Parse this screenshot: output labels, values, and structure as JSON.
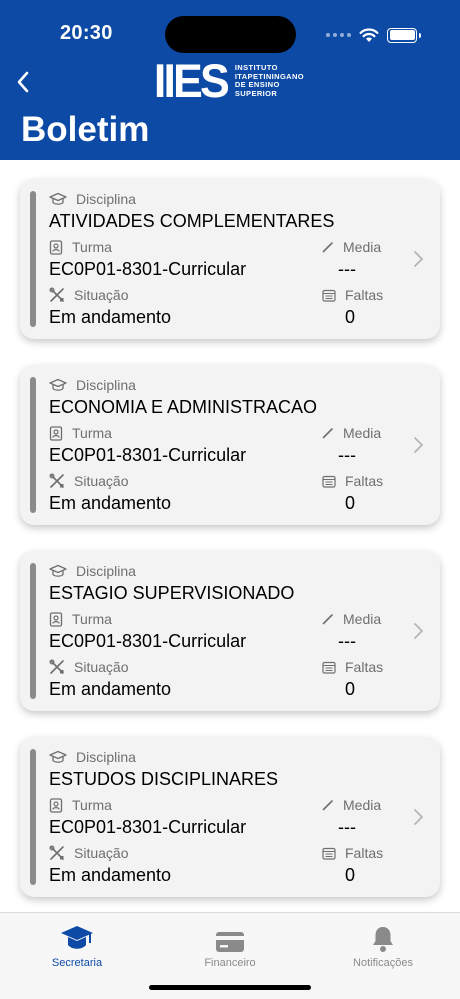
{
  "status_bar": {
    "time": "20:30"
  },
  "header": {
    "logo": {
      "mark": "IIES",
      "lines": [
        "INSTITUTO",
        "ITAPETININGANO",
        "DE ENSINO",
        "SUPERIOR"
      ]
    },
    "title": "Boletim"
  },
  "labels": {
    "disciplina": "Disciplina",
    "turma": "Turma",
    "situacao": "Situação",
    "media": "Media",
    "faltas": "Faltas"
  },
  "cards": [
    {
      "disciplina": "ATIVIDADES COMPLEMENTARES",
      "turma": "EC0P01-8301-Curricular",
      "situacao": "Em andamento",
      "media": "---",
      "faltas": "0"
    },
    {
      "disciplina": "ECONOMIA E ADMINISTRACAO",
      "turma": "EC0P01-8301-Curricular",
      "situacao": "Em andamento",
      "media": "---",
      "faltas": "0"
    },
    {
      "disciplina": "ESTAGIO SUPERVISIONADO",
      "turma": "EC0P01-8301-Curricular",
      "situacao": "Em andamento",
      "media": "---",
      "faltas": "0"
    },
    {
      "disciplina": "ESTUDOS DISCIPLINARES",
      "turma": "EC0P01-8301-Curricular",
      "situacao": "Em andamento",
      "media": "---",
      "faltas": "0"
    }
  ],
  "tabbar": {
    "tabs": [
      {
        "label": "Secretaria",
        "icon": "graduation-cap-icon",
        "active": true
      },
      {
        "label": "Financeiro",
        "icon": "credit-card-icon",
        "active": false
      },
      {
        "label": "Notificações",
        "icon": "bell-icon",
        "active": false
      }
    ]
  },
  "colors": {
    "brand": "#0d4aa6",
    "card_bg": "#f3f3f3",
    "label": "#6f6f6f",
    "inactive_tab": "#8a8a8a"
  }
}
